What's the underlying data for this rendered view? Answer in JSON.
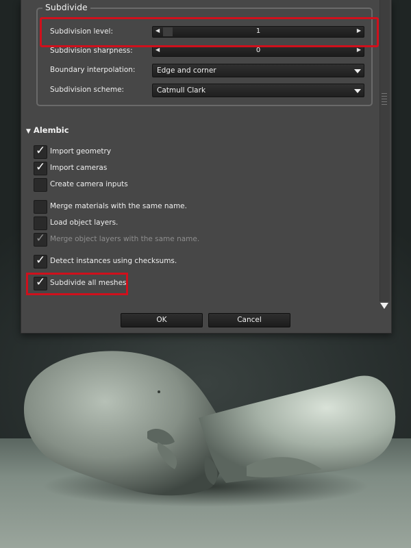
{
  "subdivide": {
    "title": "Subdivide",
    "level_label": "Subdivision level:",
    "level_value": "1",
    "sharpness_label": "Subdivision sharpness:",
    "sharpness_value": "0",
    "boundary_label": "Boundary interpolation:",
    "boundary_value": "Edge and corner",
    "scheme_label": "Subdivision scheme:",
    "scheme_value": "Catmull Clark"
  },
  "alembic": {
    "title": "Alembic",
    "options": [
      {
        "label": "Import geometry",
        "checked": true,
        "enabled": true
      },
      {
        "label": "Import cameras",
        "checked": true,
        "enabled": true
      },
      {
        "label": "Create camera inputs",
        "checked": false,
        "enabled": true
      },
      {
        "label": "Merge materials with the same name.",
        "checked": false,
        "enabled": true
      },
      {
        "label": "Load object layers.",
        "checked": false,
        "enabled": true
      },
      {
        "label": "Merge object layers with the same name.",
        "checked": true,
        "enabled": false
      },
      {
        "label": "Detect instances using checksums.",
        "checked": true,
        "enabled": true
      },
      {
        "label": "Subdivide all meshes.",
        "checked": true,
        "enabled": true
      }
    ]
  },
  "buttons": {
    "ok": "OK",
    "cancel": "Cancel"
  },
  "icons": {
    "spin_left": "◀",
    "spin_right": "▶",
    "check": "✓",
    "section_toggle": "▼"
  },
  "colors": {
    "dialog_bg": "#474747",
    "highlight": "#d0101c",
    "field_bg": "#1f1f1f"
  }
}
